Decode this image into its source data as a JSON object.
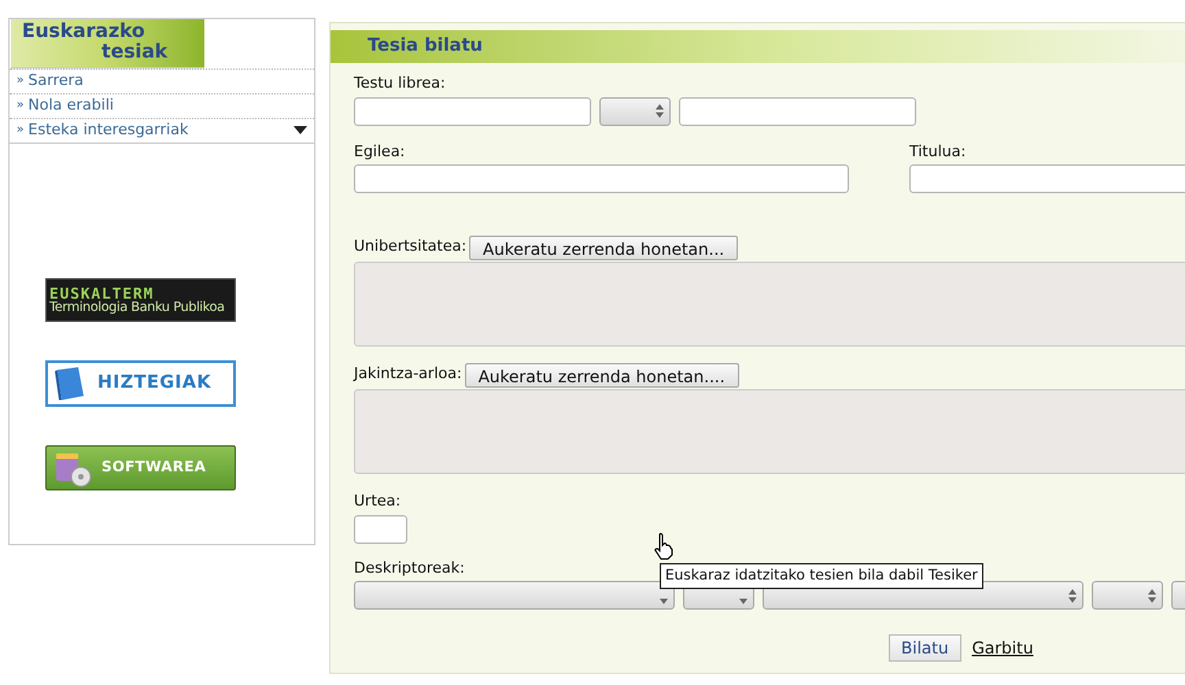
{
  "sidebar": {
    "logo": [
      "Euskarazko",
      "tesiak"
    ],
    "menu": [
      {
        "marker": "»",
        "label": "Sarrera",
        "expandable": false
      },
      {
        "marker": "»",
        "label": "Nola erabili",
        "expandable": false
      },
      {
        "marker": "»",
        "label": "Esteka interesgarriak",
        "expandable": true
      }
    ],
    "banners": [
      {
        "kind": "euskalterm",
        "title": "EUSKALTERM",
        "subtitle": "Terminologia Banku Publikoa"
      },
      {
        "kind": "hiztegiak",
        "title": "HIZTEGIAK"
      },
      {
        "kind": "softwarea",
        "title": "SOFTWAREA"
      }
    ]
  },
  "form": {
    "title": "Tesia bilatu",
    "free_text": {
      "label": "Testu librea:"
    },
    "author": {
      "label": "Egilea:"
    },
    "title_field": {
      "label": "Titulua:"
    },
    "university": {
      "label": "Unibertsitatea:",
      "button": "Aukeratu zerrenda honetan..."
    },
    "field_of_knowledge": {
      "label": "Jakintza-arloa:",
      "button": "Aukeratu zerrenda honetan...."
    },
    "year": {
      "label": "Urtea:"
    },
    "descriptors": {
      "label": "Deskriptoreak:",
      "selects": [
        {
          "kind": "dropdown"
        },
        {
          "kind": "dropdown"
        },
        {
          "kind": "spinner"
        },
        {
          "kind": "spinner"
        },
        {
          "kind": "clipped"
        }
      ]
    },
    "search_button": "Bilatu",
    "clear_link": "Garbitu"
  },
  "tooltip": "Euskaraz idatzitako tesien bila dabil Tesiker"
}
